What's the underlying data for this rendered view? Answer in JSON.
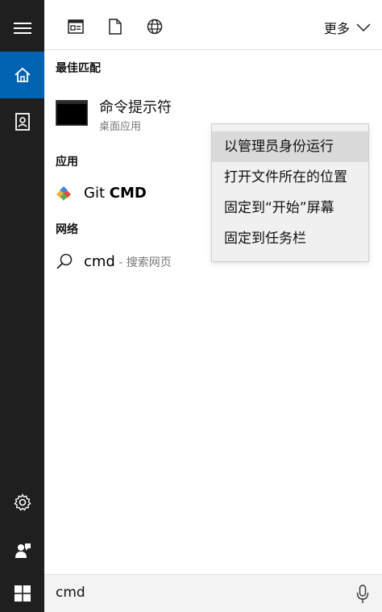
{
  "topbar": {
    "tabs": [
      {
        "icon": "app-window-icon"
      },
      {
        "icon": "document-icon"
      },
      {
        "icon": "globe-icon"
      }
    ],
    "more_label": "更多"
  },
  "sections": {
    "best_match": "最佳匹配",
    "apps": "应用",
    "web": "网络"
  },
  "best_match": {
    "title": "命令提示符",
    "subtitle": "桌面应用"
  },
  "apps": {
    "git_prefix": "Git ",
    "git_bold": "CMD"
  },
  "web": {
    "query": "cmd",
    "suffix": " - 搜索网页"
  },
  "context_menu": {
    "items": [
      {
        "label": "以管理员身份运行",
        "hovered": true
      },
      {
        "label": "打开文件所在的位置"
      },
      {
        "label": "固定到“开始”屏幕"
      },
      {
        "label": "固定到任务栏"
      }
    ]
  },
  "search": {
    "value": "cmd"
  },
  "colors": {
    "sidebar": "#1f1f1f",
    "accent": "#0063b1",
    "menu_bg": "#f0f0f0",
    "menu_hover": "#dadada"
  }
}
